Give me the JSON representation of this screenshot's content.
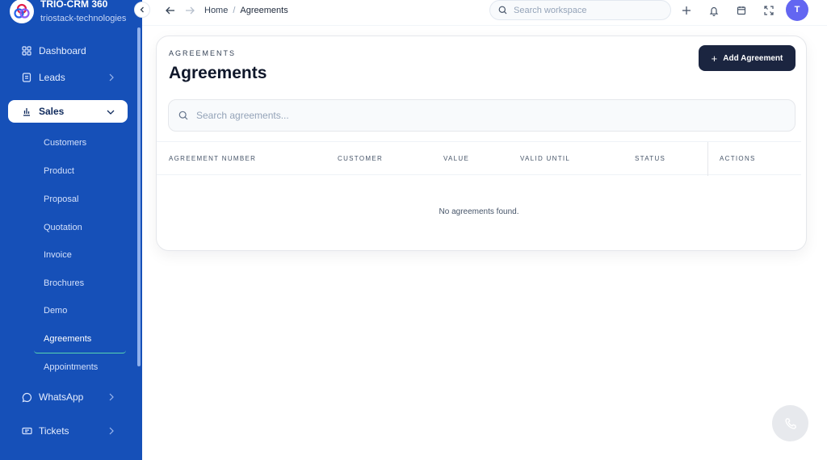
{
  "brand": {
    "title": "TRIO-CRM 360",
    "subtitle": "triostack-technologies"
  },
  "sidebar": {
    "items": [
      {
        "label": "Dashboard",
        "icon": "grid-icon"
      },
      {
        "label": "Leads",
        "icon": "document-icon"
      },
      {
        "label": "Sales",
        "icon": "bar-chart-icon"
      },
      {
        "label": "WhatsApp",
        "icon": "chat-bubble-icon"
      },
      {
        "label": "Tickets",
        "icon": "ticket-icon"
      }
    ],
    "sales_sub": [
      "Customers",
      "Product",
      "Proposal",
      "Quotation",
      "Invoice",
      "Brochures",
      "Demo",
      "Agreements",
      "Appointments"
    ]
  },
  "topbar": {
    "breadcrumb_home": "Home",
    "breadcrumb_sep": "/",
    "breadcrumb_current": "Agreements",
    "search_placeholder": "Search workspace",
    "avatar_initial": "T"
  },
  "page": {
    "eyebrow": "AGREEMENTS",
    "title": "Agreements",
    "add_button": "Add Agreement",
    "search_placeholder": "Search agreements...",
    "columns": [
      "AGREEMENT NUMBER",
      "CUSTOMER",
      "VALUE",
      "VALID UNTIL",
      "STATUS",
      "ACTIONS"
    ],
    "empty_message": "No agreements found."
  },
  "colors": {
    "sidebar": "#1650b8",
    "primary_button": "#1b2540",
    "avatar": "#6366f1",
    "active_underline": "#57d6b0"
  }
}
